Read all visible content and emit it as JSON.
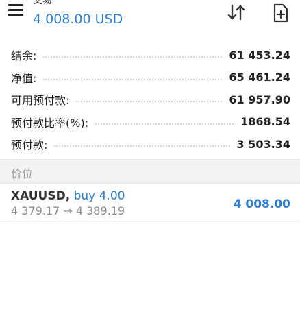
{
  "header": {
    "title": "交易",
    "subtitle": "4 008.00 USD"
  },
  "metrics": [
    {
      "label": "结余:",
      "value": "61 453.24"
    },
    {
      "label": "净值:",
      "value": "65 461.24"
    },
    {
      "label": "可用预付款:",
      "value": "61 957.90"
    },
    {
      "label": "预付款比率(%):",
      "value": "1868.54"
    },
    {
      "label": "预付款:",
      "value": "3 503.34"
    }
  ],
  "section": {
    "title": "价位"
  },
  "position": {
    "symbol": "XAUUSD,",
    "side": "buy 4.00",
    "prices": "4 379.17 → 4 389.19",
    "profit": "4 008.00"
  },
  "colors": {
    "accent": "#2f7fd1",
    "section_bg": "#f2f2f2",
    "text": "#222222"
  },
  "icons": [
    "menu-icon",
    "sort-icon",
    "add-document-icon"
  ]
}
